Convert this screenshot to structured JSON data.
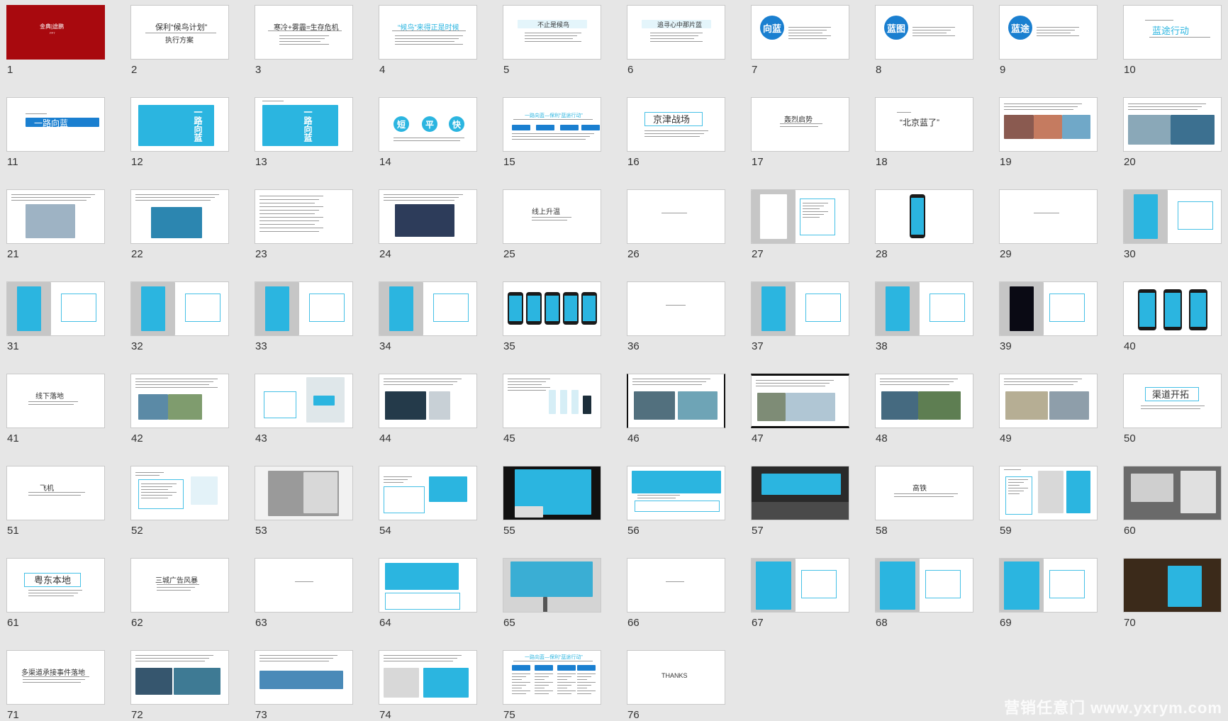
{
  "colors": {
    "bg": "#e6e6e6",
    "accent_blue": "#2bb5e0",
    "title_red": "#a8090e"
  },
  "slides": [
    {
      "n": "1",
      "lines": [
        "金典|途鹏",
        "PPT"
      ]
    },
    {
      "n": "2",
      "lines": [
        "保利“候鸟计划”",
        "执行方案"
      ]
    },
    {
      "n": "3",
      "lines": [
        "寒冷+雾霾=生存危机"
      ]
    },
    {
      "n": "4",
      "lines": [
        "“候鸟”来得正是时候"
      ]
    },
    {
      "n": "5",
      "lines": [
        "不止是候鸟"
      ]
    },
    {
      "n": "6",
      "lines": [
        "追寻心中那片蓝"
      ]
    },
    {
      "n": "7",
      "lines": [
        "向蓝"
      ]
    },
    {
      "n": "8",
      "lines": [
        "蓝图"
      ]
    },
    {
      "n": "9",
      "lines": [
        "蓝途"
      ]
    },
    {
      "n": "10",
      "lines": [
        "蓝途行动"
      ]
    },
    {
      "n": "11",
      "lines": [
        "一路向蓝"
      ]
    },
    {
      "n": "12",
      "lines": [
        "一路向蓝"
      ]
    },
    {
      "n": "13",
      "lines": [
        "一路向蓝"
      ]
    },
    {
      "n": "14",
      "lines": [
        "短",
        "平",
        "快"
      ]
    },
    {
      "n": "15",
      "lines": [
        "一路向蓝—保利“蓝途行动”"
      ]
    },
    {
      "n": "16",
      "lines": [
        "京津战场"
      ]
    },
    {
      "n": "17",
      "lines": [
        "轰烈启势"
      ]
    },
    {
      "n": "18",
      "lines": [
        "“北京蓝了”"
      ]
    },
    {
      "n": "19",
      "lines": []
    },
    {
      "n": "20",
      "lines": []
    },
    {
      "n": "21",
      "lines": []
    },
    {
      "n": "22",
      "lines": []
    },
    {
      "n": "23",
      "lines": []
    },
    {
      "n": "24",
      "lines": []
    },
    {
      "n": "25",
      "lines": [
        "线上升温"
      ]
    },
    {
      "n": "26",
      "lines": []
    },
    {
      "n": "27",
      "lines": []
    },
    {
      "n": "28",
      "lines": []
    },
    {
      "n": "29",
      "lines": []
    },
    {
      "n": "30",
      "lines": []
    },
    {
      "n": "31",
      "lines": []
    },
    {
      "n": "32",
      "lines": []
    },
    {
      "n": "33",
      "lines": []
    },
    {
      "n": "34",
      "lines": []
    },
    {
      "n": "35",
      "lines": []
    },
    {
      "n": "36",
      "lines": []
    },
    {
      "n": "37",
      "lines": []
    },
    {
      "n": "38",
      "lines": []
    },
    {
      "n": "39",
      "lines": []
    },
    {
      "n": "40",
      "lines": []
    },
    {
      "n": "41",
      "lines": [
        "线下落地"
      ]
    },
    {
      "n": "42",
      "lines": []
    },
    {
      "n": "43",
      "lines": []
    },
    {
      "n": "44",
      "lines": []
    },
    {
      "n": "45",
      "lines": []
    },
    {
      "n": "46",
      "lines": []
    },
    {
      "n": "47",
      "lines": []
    },
    {
      "n": "48",
      "lines": []
    },
    {
      "n": "49",
      "lines": []
    },
    {
      "n": "50",
      "lines": [
        "渠道开拓"
      ]
    },
    {
      "n": "51",
      "lines": [
        "飞机"
      ]
    },
    {
      "n": "52",
      "lines": []
    },
    {
      "n": "53",
      "lines": []
    },
    {
      "n": "54",
      "lines": []
    },
    {
      "n": "55",
      "lines": []
    },
    {
      "n": "56",
      "lines": []
    },
    {
      "n": "57",
      "lines": []
    },
    {
      "n": "58",
      "lines": [
        "高铁"
      ]
    },
    {
      "n": "59",
      "lines": []
    },
    {
      "n": "60",
      "lines": []
    },
    {
      "n": "61",
      "lines": [
        "粤东本地"
      ]
    },
    {
      "n": "62",
      "lines": [
        "三城广告风暴"
      ]
    },
    {
      "n": "63",
      "lines": []
    },
    {
      "n": "64",
      "lines": []
    },
    {
      "n": "65",
      "lines": []
    },
    {
      "n": "66",
      "lines": []
    },
    {
      "n": "67",
      "lines": []
    },
    {
      "n": "68",
      "lines": []
    },
    {
      "n": "69",
      "lines": []
    },
    {
      "n": "70",
      "lines": []
    },
    {
      "n": "71",
      "lines": [
        "多渠道承接事件落地"
      ]
    },
    {
      "n": "72",
      "lines": []
    },
    {
      "n": "73",
      "lines": []
    },
    {
      "n": "74",
      "lines": []
    },
    {
      "n": "75",
      "lines": [
        "一路向蓝—保利“蓝途行动”"
      ]
    },
    {
      "n": "76",
      "lines": [
        "THANKS"
      ]
    }
  ],
  "watermark": "营销任意门 www.yxrym.com"
}
